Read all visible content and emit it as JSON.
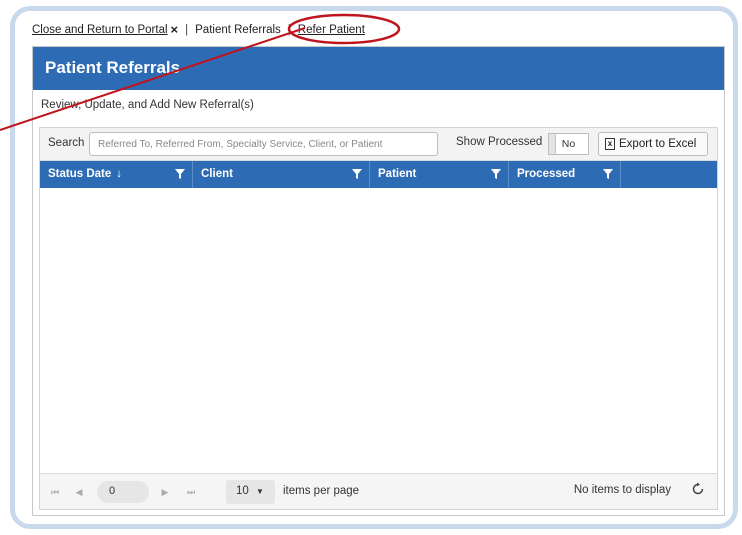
{
  "breadcrumb": {
    "close_label": "Close and Return to Portal",
    "close_icon": "×",
    "separator": "|",
    "current": "Patient Referrals",
    "refer_label": "Refer Patient"
  },
  "panel": {
    "title": "Patient Referrals",
    "subtitle": "Review, Update, and Add New Referral(s)"
  },
  "toolbar": {
    "search_label": "Search",
    "search_placeholder": "Referred To, Referred From, Specialty Service, Client, or Patient",
    "show_processed_label": "Show Processed",
    "show_processed_value": "No",
    "export_label": "Export to Excel"
  },
  "table": {
    "columns": [
      "Status Date",
      "Client",
      "Patient",
      "Processed"
    ],
    "sort_indicator": "↓",
    "rows": []
  },
  "pager": {
    "first": "⏮",
    "prev": "◀",
    "page": "0",
    "next": "▶",
    "last": "⏭",
    "page_size": "10",
    "page_size_arrow": "▼",
    "page_size_label": "items per page",
    "info": "No items to display"
  },
  "colors": {
    "header_blue": "#2d6bb5",
    "frame_border": "#c9d9ec",
    "annotation_red": "#c0141c"
  }
}
